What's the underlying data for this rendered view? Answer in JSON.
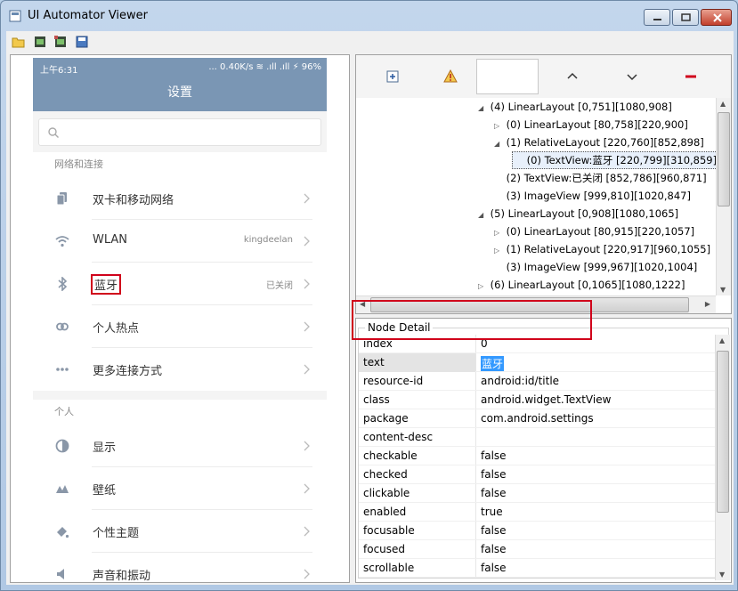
{
  "window": {
    "title": "UI Automator Viewer"
  },
  "toolbar": {
    "icons": [
      "open-folder-icon",
      "device-screenshot-icon",
      "device-screenshot-compressed-icon",
      "save-icon"
    ]
  },
  "device": {
    "status_bar": {
      "time": "上午6:31",
      "right": "... 0.40K/s  ≋ .ıll .ıll ⚡ 96%"
    },
    "app_title": "设置",
    "sections": [
      {
        "label": "网络和连接",
        "items": [
          {
            "label": "双卡和移动网络",
            "value": "",
            "icon": "sim-cards-icon"
          },
          {
            "label": "WLAN",
            "value": "kingdeelan",
            "icon": "wifi-icon"
          },
          {
            "label": "蓝牙",
            "value": "已关闭",
            "icon": "bluetooth-icon"
          },
          {
            "label": "个人热点",
            "value": "",
            "icon": "hotspot-icon"
          },
          {
            "label": "更多连接方式",
            "value": "",
            "icon": "more-dots-icon"
          }
        ]
      },
      {
        "label": "个人",
        "items": [
          {
            "label": "显示",
            "value": "",
            "icon": "display-icon"
          },
          {
            "label": "壁纸",
            "value": "",
            "icon": "wallpaper-icon"
          },
          {
            "label": "个性主题",
            "value": "",
            "icon": "theme-brush-icon"
          },
          {
            "label": "声音和振动",
            "value": "",
            "icon": "speaker-icon"
          }
        ]
      }
    ]
  },
  "tree": {
    "nodes": [
      {
        "text": "(4) LinearLayout [0,751][1080,908]",
        "expander": "open",
        "selected": false
      },
      {
        "text": "(0) LinearLayout [80,758][220,900]",
        "expander": "closed",
        "selected": false
      },
      {
        "text": "(1) RelativeLayout [220,760][852,898]",
        "expander": "open",
        "selected": false
      },
      {
        "text": "(0) TextView:蓝牙 [220,799][310,859]",
        "expander": "none",
        "selected": true
      },
      {
        "text": "(2) TextView:已关闭 [852,786][960,871]",
        "expander": "none",
        "selected": false
      },
      {
        "text": "(3) ImageView [999,810][1020,847]",
        "expander": "none",
        "selected": false
      },
      {
        "text": "(5) LinearLayout [0,908][1080,1065]",
        "expander": "open",
        "selected": false
      },
      {
        "text": "(0) LinearLayout [80,915][220,1057]",
        "expander": "closed",
        "selected": false
      },
      {
        "text": "(1) RelativeLayout [220,917][960,1055]",
        "expander": "closed",
        "selected": false
      },
      {
        "text": "(3) ImageView [999,967][1020,1004]",
        "expander": "none",
        "selected": false
      },
      {
        "text": "(6) LinearLayout [0,1065][1080,1222]",
        "expander": "closed",
        "selected": false
      }
    ]
  },
  "detail": {
    "title": "Node Detail",
    "rows": [
      {
        "key": "index",
        "value": "0"
      },
      {
        "key": "text",
        "value": "蓝牙"
      },
      {
        "key": "resource-id",
        "value": "android:id/title"
      },
      {
        "key": "class",
        "value": "android.widget.TextView"
      },
      {
        "key": "package",
        "value": "com.android.settings"
      },
      {
        "key": "content-desc",
        "value": ""
      },
      {
        "key": "checkable",
        "value": "false"
      },
      {
        "key": "checked",
        "value": "false"
      },
      {
        "key": "clickable",
        "value": "false"
      },
      {
        "key": "enabled",
        "value": "true"
      },
      {
        "key": "focusable",
        "value": "false"
      },
      {
        "key": "focused",
        "value": "false"
      },
      {
        "key": "scrollable",
        "value": "false"
      }
    ]
  },
  "colors": {
    "accent_red": "#d0021b",
    "phone_bar": "#7a96b4",
    "selection": "#3399ff"
  }
}
